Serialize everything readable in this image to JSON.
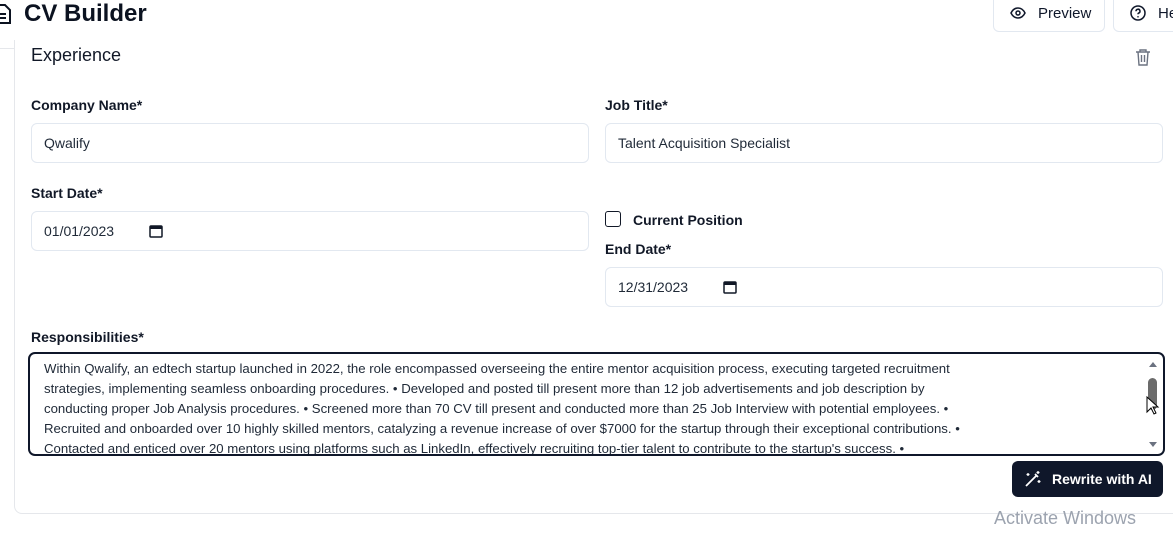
{
  "app": {
    "title": "CV Builder"
  },
  "header": {
    "preview_label": "Preview",
    "help_label": "He"
  },
  "section": {
    "title": "Experience"
  },
  "form": {
    "company_label": "Company Name*",
    "company_value": "Qwalify",
    "job_title_label": "Job Title*",
    "job_title_value": "Talent Acquisition Specialist",
    "start_date_label": "Start Date*",
    "start_date_value": "01/01/2023",
    "current_position_label": "Current Position",
    "current_position_checked": false,
    "end_date_label": "End Date*",
    "end_date_value": "12/31/2023",
    "responsibilities_label": "Responsibilities*",
    "responsibilities_value": "Within Qwalify, an edtech startup launched in 2022, the role encompassed overseeing the entire mentor acquisition process, executing targeted recruitment\nstrategies, implementing seamless onboarding procedures. • Developed and posted till present more than 12 job advertisements and job description by\nconducting proper Job Analysis procedures. • Screened more than 70 CV till present and conducted more than 25 Job Interview with potential employees. •\nRecruited and onboarded over 10 highly skilled mentors, catalyzing a revenue increase of over $7000 for the startup through their exceptional contributions. •\nContacted and enticed over 20 mentors using platforms such as LinkedIn, effectively recruiting top-tier talent to contribute to the startup's success. •"
  },
  "actions": {
    "rewrite_label": "Rewrite with AI"
  },
  "overlay": {
    "watermark": "Activate Windows"
  },
  "icons": {
    "app": "document-icon",
    "preview": "eye-icon",
    "help": "help-circle-icon",
    "delete": "trash-icon",
    "calendar": "calendar-icon",
    "rewrite": "magic-wand-icon"
  }
}
